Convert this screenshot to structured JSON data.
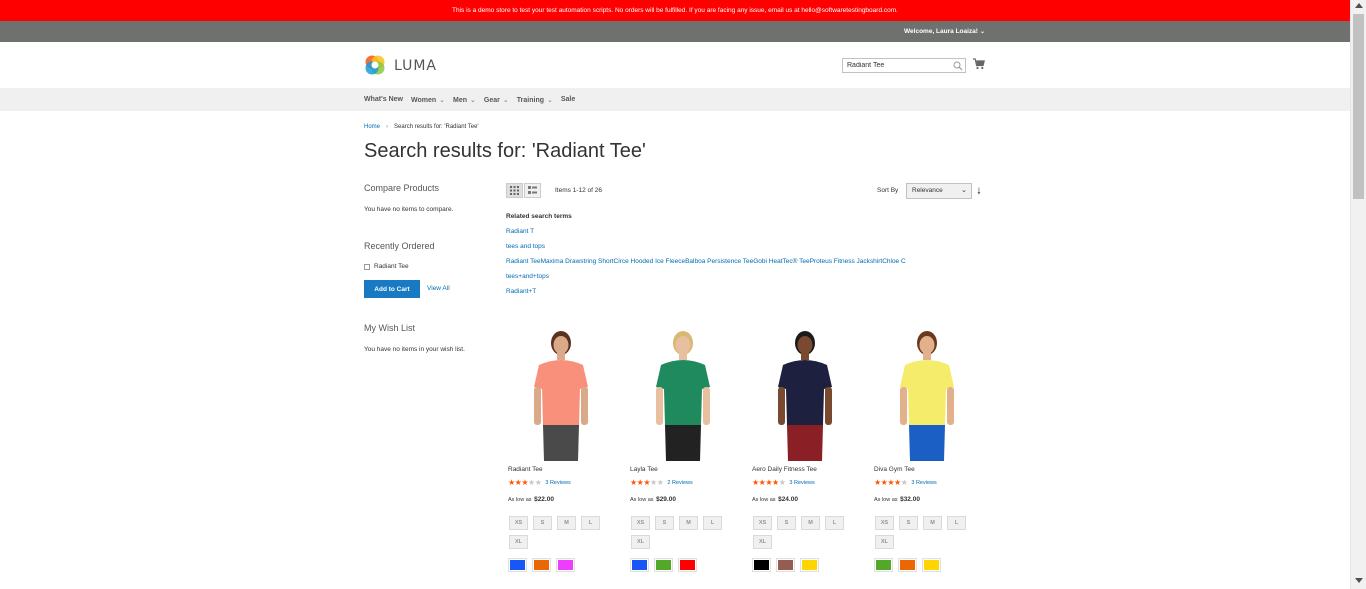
{
  "notice": "This is a demo store to test your test automation scripts. No orders will be fulfilled. If you are facing any issue, email us at hello@softwaretestingboard.com.",
  "header": {
    "welcome": "Welcome, Laura Loaiza!",
    "logo_text": "LUMA",
    "search_value": "Radiant Tee"
  },
  "nav": [
    {
      "label": "What's New",
      "dropdown": false
    },
    {
      "label": "Women",
      "dropdown": true
    },
    {
      "label": "Men",
      "dropdown": true
    },
    {
      "label": "Gear",
      "dropdown": true
    },
    {
      "label": "Training",
      "dropdown": true
    },
    {
      "label": "Sale",
      "dropdown": false
    }
  ],
  "breadcrumb": {
    "home": "Home",
    "current": "Search results for: 'Radiant Tee'"
  },
  "page_title": "Search results for: 'Radiant Tee'",
  "sidebar": {
    "compare_title": "Compare Products",
    "compare_text": "You have no items to compare.",
    "recent_title": "Recently Ordered",
    "recent_item": "Radiant Tee",
    "add_to_cart": "Add to Cart",
    "view_all": "View All",
    "wish_title": "My Wish List",
    "wish_text": "You have no items in your wish list."
  },
  "toolbar": {
    "amount": "Items 1-12 of 26",
    "sort_label": "Sort By",
    "sort_value": "Relevance",
    "sort_direction_icon": "arrow-down-icon"
  },
  "related": {
    "title": "Related search terms",
    "terms": [
      "Radiant T",
      "tees and tops",
      "Radiant TeeMaxima Drawstring ShortCirce Hooded Ice FleeceBalboa Persistence TeeGobi HeatTec® TeeProteus Fitness JackshirtChloe C",
      "tees+and+tops",
      "Radiant+T"
    ]
  },
  "products": [
    {
      "name": "Radiant Tee",
      "rating": 3,
      "reviews": "3 Reviews",
      "price_prefix": "As low as",
      "price": "$22.00",
      "sizes": [
        "XS",
        "S",
        "M",
        "L",
        "XL"
      ],
      "colors": [
        "#1857f7",
        "#eb6703",
        "#ef3dff"
      ],
      "shirt": "#f9907c",
      "skin": "#d9a98a",
      "hair": "#5a3220",
      "bottom": "#4a4a4a"
    },
    {
      "name": "Layla Tee",
      "rating": 3,
      "reviews": "2 Reviews",
      "price_prefix": "As low as",
      "price": "$29.00",
      "sizes": [
        "XS",
        "S",
        "M",
        "L",
        "XL"
      ],
      "colors": [
        "#1857f7",
        "#53a828",
        "#ff0000"
      ],
      "shirt": "#1f8a5e",
      "skin": "#e8c0a0",
      "hair": "#d9b870",
      "bottom": "#222222"
    },
    {
      "name": "Aero Daily Fitness Tee",
      "rating": 4,
      "reviews": "3 Reviews",
      "price_prefix": "As low as",
      "price": "$24.00",
      "sizes": [
        "XS",
        "S",
        "M",
        "L",
        "XL"
      ],
      "colors": [
        "#000000",
        "#945d52",
        "#ffd500"
      ],
      "shirt": "#1e2040",
      "skin": "#7a4a30",
      "hair": "#1b1b1b",
      "bottom": "#8a2026"
    },
    {
      "name": "Diva Gym Tee",
      "rating": 4.5,
      "reviews": "3 Reviews",
      "price_prefix": "As low as",
      "price": "$32.00",
      "sizes": [
        "XS",
        "S",
        "M",
        "L",
        "XL"
      ],
      "colors": [
        "#53a828",
        "#eb6703",
        "#ffd500"
      ],
      "shirt": "#f4ec6a",
      "skin": "#e3b08c",
      "hair": "#6a3a1f",
      "bottom": "#1b5fc4"
    }
  ]
}
